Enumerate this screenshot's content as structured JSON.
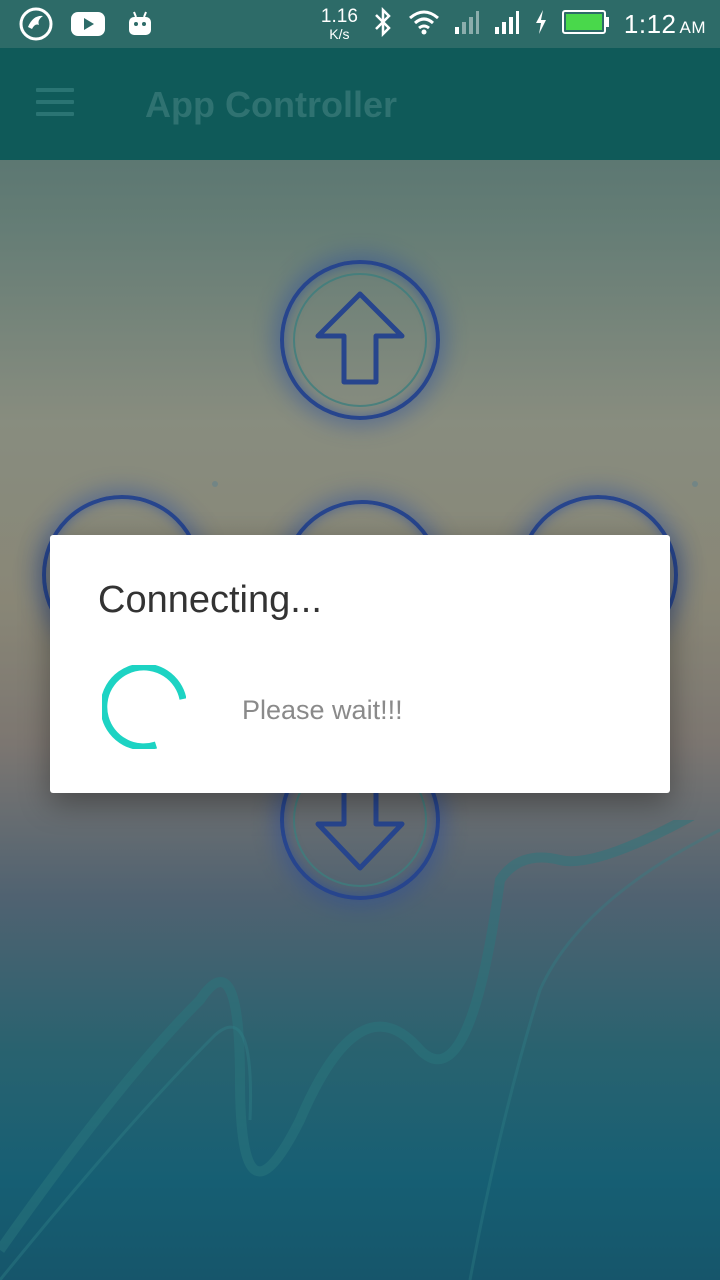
{
  "status_bar": {
    "net_speed_value": "1.16",
    "net_speed_unit": "K/s",
    "time": "1:12",
    "ampm": "AM",
    "icons": [
      "phoenix-app-icon",
      "youtube-icon",
      "android-icon",
      "bluetooth-icon",
      "wifi-icon",
      "signal-weak-icon",
      "signal-icon",
      "charging-icon",
      "battery-icon"
    ],
    "battery_color": "#49d84b"
  },
  "app_bar": {
    "title": "App Controller",
    "menu_icon": "menu-icon",
    "color": "#0f5a59"
  },
  "controls": {
    "up": "arrow-up-icon",
    "down": "arrow-down-icon",
    "accent": "#2b3fb3"
  },
  "dialog": {
    "title": "Connecting...",
    "message": "Please wait!!!",
    "spinner_color": "#1dd3c3"
  }
}
